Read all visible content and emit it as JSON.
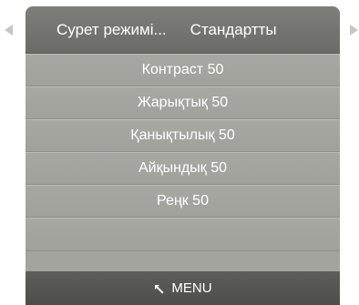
{
  "header": {
    "mode_label": "Сурет режимі...",
    "mode_value": "Стандартты"
  },
  "items": [
    {
      "label": "Контраст 50"
    },
    {
      "label": "Жарықтық 50"
    },
    {
      "label": "Қанықтылық 50"
    },
    {
      "label": "Айқындық 50"
    },
    {
      "label": "Реңк 50"
    }
  ],
  "footer": {
    "menu_label": "MENU",
    "icon": "return-icon"
  },
  "colors": {
    "arrow": "#c7c7c7",
    "header_bg": "#737470",
    "item_bg": "#a4a49f",
    "footer_bg": "#555651",
    "text": "#ffffff"
  }
}
